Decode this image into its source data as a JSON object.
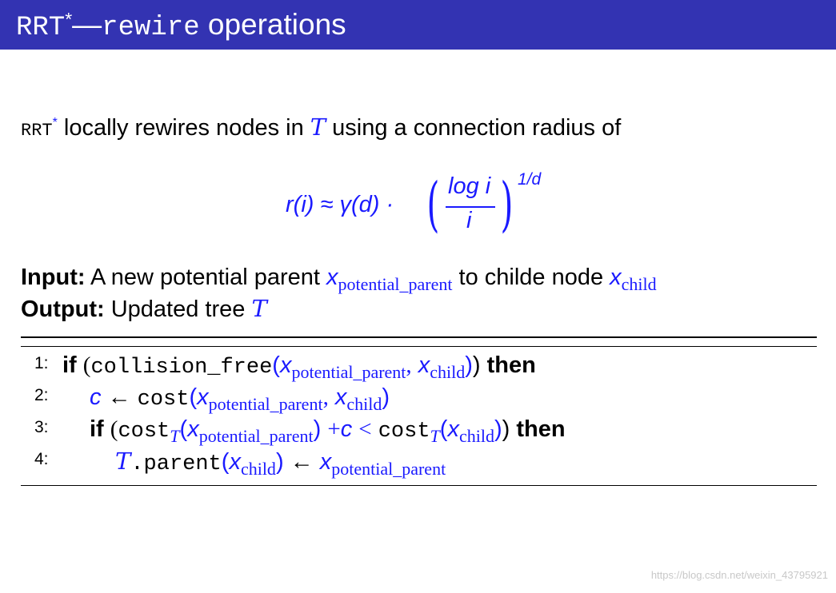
{
  "slide": {
    "title": {
      "prefix": "RRT",
      "sup": "*",
      "dash": "—",
      "code": "rewire",
      "suffix": " operations"
    },
    "intro": {
      "rrt": "RRT",
      "star": "*",
      "text1": " locally rewires nodes in ",
      "tree_symbol": "T",
      "text2": " using a connection radius of"
    },
    "formula": {
      "lhs": "r(i) ≈ γ(d) ·",
      "numerator": "log i",
      "denominator": "i",
      "exponent": "1/d"
    },
    "input": {
      "label": "Input:",
      "text1": " A new potential parent ",
      "var1": "x",
      "sub1": "potential_parent",
      "text2": " to childe node ",
      "var2": "x",
      "sub2": "child"
    },
    "output": {
      "label": "Output:",
      "text": " Updated tree ",
      "tree_symbol": "T"
    },
    "algorithm": [
      {
        "num": "1:",
        "kw1": "if",
        "body": "(collision_free(x potential_parent, x child))",
        "kw2": "then"
      },
      {
        "num": "2:",
        "body": "c ← cost(x potential_parent, x child)"
      },
      {
        "num": "3:",
        "kw1": "if",
        "body": "(cost T(x potential_parent) + c < cost T(x child))",
        "kw2": "then"
      },
      {
        "num": "4:",
        "body": "T.parent(x child) ← x potential_parent"
      }
    ],
    "tokens": {
      "x": "x",
      "c": "c",
      "T": "T",
      "pp": "potential_parent",
      "ch": "child",
      "collision_free": "collision_free",
      "cost": "cost",
      "parent": ".parent",
      "arrow": "←",
      "plus": "+",
      "lt": "<",
      "comma": ","
    },
    "watermark": "https://blog.csdn.net/weixin_43795921"
  },
  "colors": {
    "title_bar": "#3333b2",
    "title_text": "#ffffff",
    "math_blue": "#1a1aff",
    "text": "#000000",
    "watermark": "#c8c8c8"
  }
}
